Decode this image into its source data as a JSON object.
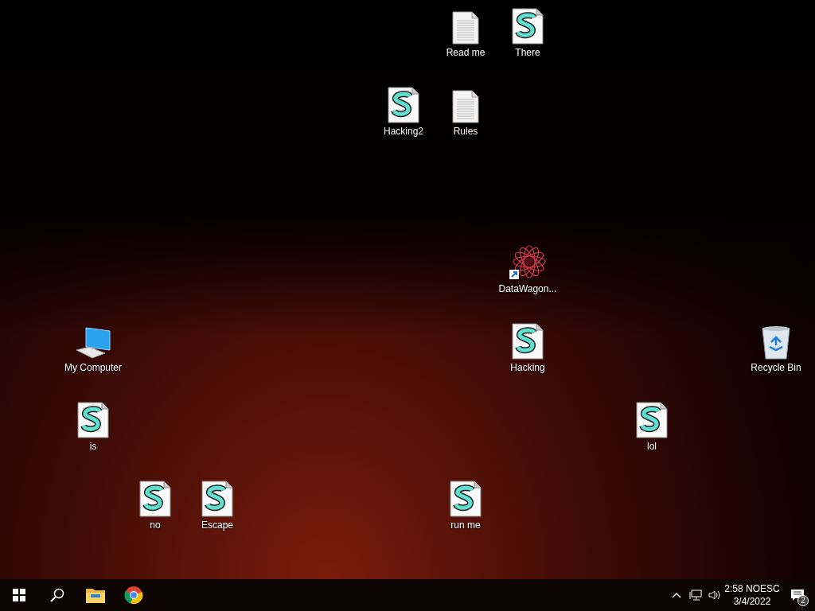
{
  "desktop_icons": [
    {
      "label": "Read me",
      "kind": "text"
    },
    {
      "label": "There",
      "kind": "script"
    },
    {
      "label": "Hacking2",
      "kind": "script"
    },
    {
      "label": "Rules",
      "kind": "text"
    },
    {
      "label": "DataWagon...",
      "kind": "shortcut"
    },
    {
      "label": "My Computer",
      "kind": "computer"
    },
    {
      "label": "Hacking",
      "kind": "script"
    },
    {
      "label": "Recycle Bin",
      "kind": "recyclebin"
    },
    {
      "label": "is",
      "kind": "script"
    },
    {
      "label": "lol",
      "kind": "script"
    },
    {
      "label": "no",
      "kind": "script"
    },
    {
      "label": "Escape",
      "kind": "script"
    },
    {
      "label": "run me",
      "kind": "script"
    }
  ],
  "taskbar": {
    "clock": {
      "time": "2:58 NOESC",
      "date": "3/4/2022"
    },
    "notification_count": "2"
  }
}
